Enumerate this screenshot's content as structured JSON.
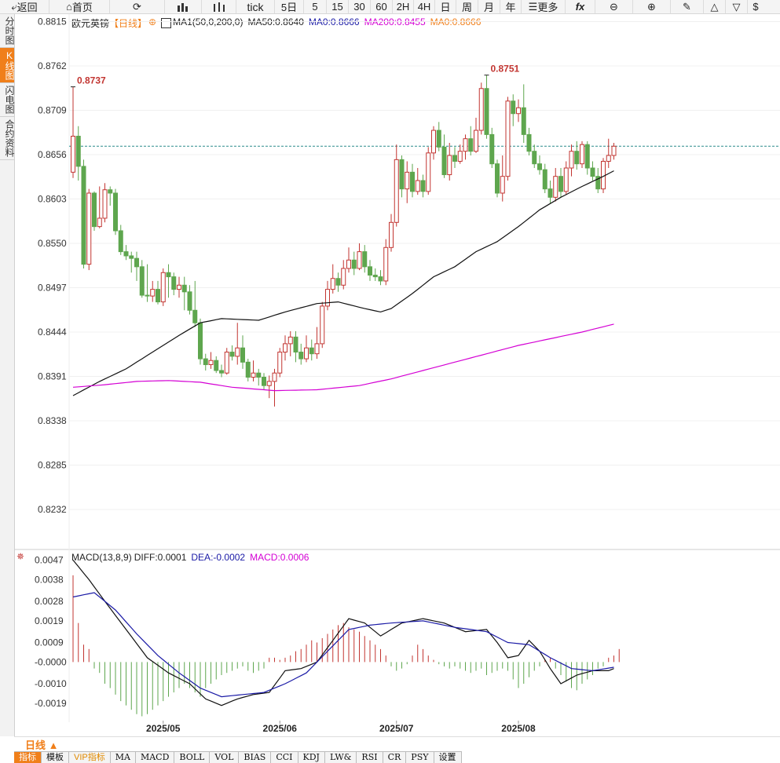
{
  "toolbar": {
    "back": "返回",
    "home": "首页",
    "tick": "tick",
    "periods": [
      "5日",
      "5",
      "15",
      "30",
      "60",
      "2H",
      "4H",
      "日",
      "周",
      "月",
      "年"
    ],
    "more": "更多",
    "fx": "fx",
    "last": "$"
  },
  "side_tabs": [
    "分时图",
    "K线图",
    "闪电图",
    "合约资料"
  ],
  "side_active": 1,
  "legend_main": {
    "symbol": "欧元英镑",
    "period": "【日线】",
    "ma_set": "MA1(50,0,200,0)",
    "ma50": "MA50:0.8640",
    "ma0a": "MA0:0.8666",
    "ma200": "MA200:0.8455",
    "ma0b": "MA0:0.8666"
  },
  "legend_macd": {
    "name": "MACD(13,8,9)",
    "diff": "DIFF:0.0001",
    "dea": "DEA:-0.0002",
    "macd": "MACD:0.0006"
  },
  "colors": {
    "up": "#c23531",
    "down": "#5ea64e",
    "ma50": "#111111",
    "ma200": "#d400d4",
    "diff": "#111111",
    "dea": "#1a1aa6",
    "accent": "#f07f1a",
    "current": "#2a8c8c"
  },
  "timeframe_label": "日线 ▲",
  "indicator_tabs": [
    "指标",
    "模板",
    "VIP指标",
    "MA",
    "MACD",
    "BOLL",
    "VOL",
    "BIAS",
    "CCI",
    "KDJ",
    "LW&",
    "RSI",
    "CR",
    "PSY",
    "设置"
  ],
  "chart_data": {
    "type": "candlestick",
    "title": "欧元英镑",
    "y_ticks": [
      "0.8815",
      "0.8762",
      "0.8709",
      "0.8656",
      "0.8603",
      "0.8550",
      "0.8497",
      "0.8444",
      "0.8391",
      "0.8338",
      "0.8285",
      "0.8232"
    ],
    "ylim": [
      0.8186,
      0.8822
    ],
    "x_labels": [
      "2025/05",
      "2025/06",
      "2025/07",
      "2025/08"
    ],
    "x_label_index": [
      17,
      39,
      61,
      84
    ],
    "current_price": 0.8666,
    "high_label": "0.8751",
    "high_index": 78,
    "high_value": 0.8751,
    "left_label": "0.8737",
    "left_index": 0,
    "left_value": 0.8737,
    "candles": [
      [
        0.8635,
        0.8678,
        0.8737,
        0.8628
      ],
      [
        0.8678,
        0.8642,
        0.869,
        0.8625
      ],
      [
        0.8642,
        0.8525,
        0.865,
        0.852
      ],
      [
        0.8525,
        0.861,
        0.8615,
        0.8518
      ],
      [
        0.861,
        0.857,
        0.8612,
        0.8565
      ],
      [
        0.857,
        0.858,
        0.8618,
        0.8568
      ],
      [
        0.858,
        0.8614,
        0.8622,
        0.8575
      ],
      [
        0.8614,
        0.861,
        0.8618,
        0.8595
      ],
      [
        0.861,
        0.8565,
        0.8615,
        0.856
      ],
      [
        0.8565,
        0.854,
        0.8572,
        0.8536
      ],
      [
        0.854,
        0.8535,
        0.8548,
        0.853
      ],
      [
        0.8535,
        0.8532,
        0.854,
        0.8515
      ],
      [
        0.8532,
        0.8522,
        0.854,
        0.8505
      ],
      [
        0.8522,
        0.8488,
        0.853,
        0.8485
      ],
      [
        0.8488,
        0.8487,
        0.8525,
        0.848
      ],
      [
        0.8487,
        0.8495,
        0.8505,
        0.848
      ],
      [
        0.8495,
        0.848,
        0.8505,
        0.8477
      ],
      [
        0.848,
        0.8515,
        0.852,
        0.8475
      ],
      [
        0.8515,
        0.851,
        0.8525,
        0.8485
      ],
      [
        0.851,
        0.8495,
        0.8515,
        0.8488
      ],
      [
        0.8495,
        0.85,
        0.851,
        0.8485
      ],
      [
        0.85,
        0.8492,
        0.851,
        0.847
      ],
      [
        0.8492,
        0.847,
        0.85,
        0.8465
      ],
      [
        0.847,
        0.8455,
        0.8505,
        0.845
      ],
      [
        0.8455,
        0.8412,
        0.846,
        0.8405
      ],
      [
        0.8412,
        0.8405,
        0.8418,
        0.8398
      ],
      [
        0.8405,
        0.841,
        0.842,
        0.84
      ],
      [
        0.841,
        0.8398,
        0.8415,
        0.8395
      ],
      [
        0.8398,
        0.8395,
        0.8405,
        0.839
      ],
      [
        0.8395,
        0.842,
        0.8425,
        0.8393
      ],
      [
        0.842,
        0.8415,
        0.8428,
        0.841
      ],
      [
        0.8415,
        0.8425,
        0.8455,
        0.8405
      ],
      [
        0.8425,
        0.8408,
        0.844,
        0.84
      ],
      [
        0.8408,
        0.839,
        0.8412,
        0.8385
      ],
      [
        0.839,
        0.8395,
        0.841,
        0.8385
      ],
      [
        0.8395,
        0.839,
        0.84,
        0.838
      ],
      [
        0.839,
        0.838,
        0.8395,
        0.8375
      ],
      [
        0.838,
        0.8385,
        0.8392,
        0.8365
      ],
      [
        0.8385,
        0.8395,
        0.84,
        0.8355
      ],
      [
        0.8395,
        0.842,
        0.8425,
        0.839
      ],
      [
        0.842,
        0.843,
        0.844,
        0.841
      ],
      [
        0.843,
        0.8438,
        0.8445,
        0.8415
      ],
      [
        0.8438,
        0.842,
        0.8445,
        0.8408
      ],
      [
        0.842,
        0.8412,
        0.843,
        0.8405
      ],
      [
        0.8412,
        0.8425,
        0.844,
        0.8408
      ],
      [
        0.8425,
        0.8418,
        0.8435,
        0.841
      ],
      [
        0.8418,
        0.843,
        0.845,
        0.8412
      ],
      [
        0.843,
        0.8475,
        0.848,
        0.8425
      ],
      [
        0.8475,
        0.8495,
        0.8505,
        0.847
      ],
      [
        0.8495,
        0.8508,
        0.8525,
        0.849
      ],
      [
        0.8508,
        0.85,
        0.8515,
        0.8492
      ],
      [
        0.85,
        0.852,
        0.853,
        0.8495
      ],
      [
        0.852,
        0.853,
        0.8545,
        0.8515
      ],
      [
        0.853,
        0.852,
        0.854,
        0.8512
      ],
      [
        0.852,
        0.854,
        0.855,
        0.8518
      ],
      [
        0.854,
        0.8522,
        0.8548,
        0.8515
      ],
      [
        0.8522,
        0.8512,
        0.853,
        0.8505
      ],
      [
        0.8512,
        0.851,
        0.852,
        0.8505
      ],
      [
        0.851,
        0.8505,
        0.8518,
        0.85
      ],
      [
        0.8505,
        0.8545,
        0.8555,
        0.85
      ],
      [
        0.8545,
        0.8575,
        0.8585,
        0.854
      ],
      [
        0.8575,
        0.865,
        0.8668,
        0.857
      ],
      [
        0.865,
        0.8615,
        0.8655,
        0.8605
      ],
      [
        0.8615,
        0.8635,
        0.8648,
        0.8598
      ],
      [
        0.8635,
        0.8612,
        0.8645,
        0.8605
      ],
      [
        0.8612,
        0.8625,
        0.864,
        0.8608
      ],
      [
        0.8625,
        0.8612,
        0.8632,
        0.8605
      ],
      [
        0.8612,
        0.8658,
        0.8665,
        0.8608
      ],
      [
        0.8658,
        0.8685,
        0.869,
        0.865
      ],
      [
        0.8685,
        0.8665,
        0.8695,
        0.866
      ],
      [
        0.8665,
        0.8632,
        0.868,
        0.8628
      ],
      [
        0.8632,
        0.8655,
        0.867,
        0.8625
      ],
      [
        0.8655,
        0.8648,
        0.8665,
        0.864
      ],
      [
        0.8648,
        0.866,
        0.8668,
        0.8645
      ],
      [
        0.866,
        0.8675,
        0.868,
        0.865
      ],
      [
        0.8675,
        0.866,
        0.869,
        0.8655
      ],
      [
        0.866,
        0.8685,
        0.87,
        0.8658
      ],
      [
        0.8685,
        0.8735,
        0.8742,
        0.868
      ],
      [
        0.8735,
        0.868,
        0.8751,
        0.8675
      ],
      [
        0.868,
        0.8645,
        0.8688,
        0.864
      ],
      [
        0.8645,
        0.861,
        0.865,
        0.8605
      ],
      [
        0.861,
        0.863,
        0.8655,
        0.86
      ],
      [
        0.863,
        0.872,
        0.8725,
        0.8625
      ],
      [
        0.872,
        0.8705,
        0.8728,
        0.869
      ],
      [
        0.8705,
        0.8712,
        0.8722,
        0.8695
      ],
      [
        0.8712,
        0.868,
        0.874,
        0.867
      ],
      [
        0.868,
        0.866,
        0.8688,
        0.8655
      ],
      [
        0.866,
        0.8645,
        0.8668,
        0.864
      ],
      [
        0.8645,
        0.8638,
        0.8655,
        0.8632
      ],
      [
        0.8638,
        0.8615,
        0.8645,
        0.861
      ],
      [
        0.8615,
        0.8605,
        0.8625,
        0.8598
      ],
      [
        0.8605,
        0.863,
        0.864,
        0.86
      ],
      [
        0.863,
        0.8612,
        0.864,
        0.8605
      ],
      [
        0.8612,
        0.864,
        0.8648,
        0.8608
      ],
      [
        0.864,
        0.866,
        0.8668,
        0.863
      ],
      [
        0.866,
        0.8645,
        0.8672,
        0.8638
      ],
      [
        0.8645,
        0.8668,
        0.8672,
        0.864
      ],
      [
        0.8668,
        0.864,
        0.8672,
        0.8632
      ],
      [
        0.864,
        0.863,
        0.8648,
        0.8625
      ],
      [
        0.863,
        0.8615,
        0.864,
        0.861
      ],
      [
        0.8615,
        0.8648,
        0.8652,
        0.861
      ],
      [
        0.8648,
        0.8655,
        0.8675,
        0.864
      ],
      [
        0.8655,
        0.8666,
        0.867,
        0.865
      ]
    ],
    "series": [
      {
        "name": "MA50",
        "values_sparse": [
          [
            0,
            0.8368
          ],
          [
            5,
            0.8385
          ],
          [
            10,
            0.84
          ],
          [
            15,
            0.842
          ],
          [
            20,
            0.844
          ],
          [
            24,
            0.8455
          ],
          [
            28,
            0.846
          ],
          [
            35,
            0.8458
          ],
          [
            40,
            0.8468
          ],
          [
            46,
            0.8478
          ],
          [
            50,
            0.848
          ],
          [
            55,
            0.8472
          ],
          [
            58,
            0.8468
          ],
          [
            60,
            0.8472
          ],
          [
            64,
            0.849
          ],
          [
            68,
            0.851
          ],
          [
            72,
            0.8522
          ],
          [
            76,
            0.854
          ],
          [
            80,
            0.8552
          ],
          [
            84,
            0.857
          ],
          [
            88,
            0.859
          ],
          [
            92,
            0.8605
          ],
          [
            96,
            0.8618
          ],
          [
            100,
            0.863
          ],
          [
            103,
            0.864
          ]
        ]
      },
      {
        "name": "MA200",
        "values_sparse": [
          [
            0,
            0.8378
          ],
          [
            6,
            0.8381
          ],
          [
            12,
            0.8385
          ],
          [
            18,
            0.8386
          ],
          [
            24,
            0.8384
          ],
          [
            30,
            0.8378
          ],
          [
            38,
            0.8374
          ],
          [
            46,
            0.8375
          ],
          [
            54,
            0.838
          ],
          [
            60,
            0.8388
          ],
          [
            66,
            0.8398
          ],
          [
            72,
            0.8408
          ],
          [
            78,
            0.8418
          ],
          [
            84,
            0.8428
          ],
          [
            90,
            0.8436
          ],
          [
            96,
            0.8444
          ],
          [
            103,
            0.8455
          ]
        ]
      }
    ],
    "macd": {
      "y_ticks": [
        "0.0047",
        "0.0038",
        "0.0028",
        "0.0019",
        "0.0009",
        "-0.0000",
        "-0.0010",
        "-0.0019"
      ],
      "ylim": [
        -0.0027,
        0.0049
      ],
      "hist": [
        0.004,
        0.0018,
        0.0008,
        0.0006,
        -0.0003,
        -0.0005,
        -0.001,
        -0.0012,
        -0.0015,
        -0.0018,
        -0.002,
        -0.0022,
        -0.0024,
        -0.0025,
        -0.0024,
        -0.0022,
        -0.002,
        -0.0018,
        -0.0016,
        -0.0014,
        -0.0012,
        -0.001,
        -0.0012,
        -0.0014,
        -0.0016,
        -0.0012,
        -0.001,
        -0.0008,
        -0.0006,
        -0.0005,
        -0.0004,
        -0.0003,
        -0.0002,
        -0.0004,
        -0.0005,
        -0.0004,
        -0.0003,
        0.0002,
        0.0002,
        0.0001,
        0.0002,
        0.0003,
        0.0005,
        0.0006,
        0.0008,
        0.001,
        0.0009,
        0.0011,
        0.0013,
        0.0015,
        0.0017,
        0.0018,
        0.0016,
        0.0015,
        0.0014,
        0.0012,
        0.001,
        0.0008,
        0.0006,
        0.0003,
        -0.0002,
        -0.0004,
        -0.0003,
        -0.0001,
        0.0003,
        0.0008,
        0.0006,
        0.0003,
        0.0001,
        -0.0001,
        -0.0002,
        -0.0003,
        -0.0002,
        -0.0003,
        -0.0004,
        -0.0005,
        -0.0004,
        -0.0003,
        -0.0006,
        -0.0005,
        -0.0004,
        -0.0003,
        -0.0004,
        -0.0008,
        -0.0012,
        -0.001,
        -0.0007,
        -0.0004,
        -0.0002,
        0.0001,
        0.0002,
        -0.0003,
        -0.0006,
        -0.0009,
        -0.0012,
        -0.0013,
        -0.001,
        -0.0008,
        -0.0006,
        -0.0003,
        -0.0002,
        0.0002,
        0.0003,
        0.0006
      ],
      "diff_sparse": [
        [
          0,
          0.0047
        ],
        [
          3,
          0.0038
        ],
        [
          6,
          0.0028
        ],
        [
          10,
          0.0015
        ],
        [
          14,
          0.0002
        ],
        [
          18,
          -0.0005
        ],
        [
          22,
          -0.001
        ],
        [
          25,
          -0.0017
        ],
        [
          28,
          -0.002
        ],
        [
          31,
          -0.0017
        ],
        [
          34,
          -0.0015
        ],
        [
          37,
          -0.0014
        ],
        [
          40,
          -0.0004
        ],
        [
          43,
          -0.0003
        ],
        [
          46,
          0.0
        ],
        [
          49,
          0.001
        ],
        [
          52,
          0.002
        ],
        [
          55,
          0.0018
        ],
        [
          58,
          0.0012
        ],
        [
          62,
          0.0018
        ],
        [
          66,
          0.002
        ],
        [
          70,
          0.0018
        ],
        [
          74,
          0.0014
        ],
        [
          78,
          0.0015
        ],
        [
          80,
          0.0009
        ],
        [
          82,
          0.0002
        ],
        [
          84,
          0.0003
        ],
        [
          86,
          0.001
        ],
        [
          88,
          0.0005
        ],
        [
          90,
          -0.0003
        ],
        [
          92,
          -0.001
        ],
        [
          95,
          -0.0006
        ],
        [
          98,
          -0.0004
        ],
        [
          101,
          -0.0004
        ],
        [
          103,
          -0.0002
        ]
      ],
      "dea_sparse": [
        [
          0,
          0.003
        ],
        [
          4,
          0.0032
        ],
        [
          8,
          0.0024
        ],
        [
          12,
          0.0013
        ],
        [
          16,
          0.0003
        ],
        [
          20,
          -0.0005
        ],
        [
          24,
          -0.0012
        ],
        [
          28,
          -0.0016
        ],
        [
          32,
          -0.0015
        ],
        [
          36,
          -0.0014
        ],
        [
          40,
          -0.001
        ],
        [
          44,
          -0.0005
        ],
        [
          48,
          0.0005
        ],
        [
          52,
          0.0015
        ],
        [
          56,
          0.0017
        ],
        [
          60,
          0.0018
        ],
        [
          66,
          0.0019
        ],
        [
          72,
          0.0016
        ],
        [
          78,
          0.0014
        ],
        [
          82,
          0.0009
        ],
        [
          86,
          0.0008
        ],
        [
          90,
          0.0002
        ],
        [
          94,
          -0.0003
        ],
        [
          98,
          -0.0004
        ],
        [
          103,
          -0.0002
        ]
      ]
    }
  }
}
